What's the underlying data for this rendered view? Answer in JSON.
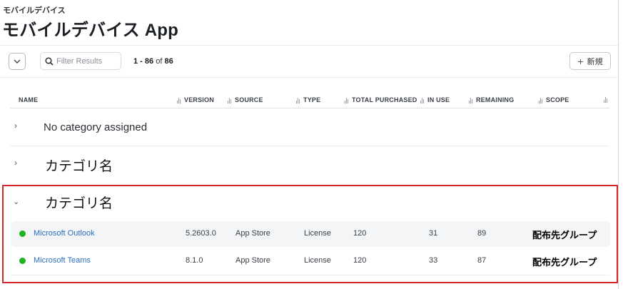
{
  "header": {
    "breadcrumb": "モバイルデバイス",
    "title": "モバイルデバイス App"
  },
  "toolbar": {
    "search_placeholder": "Filter Results",
    "pagination_range": "1 - 86",
    "pagination_of": "of",
    "pagination_total": "86",
    "new_button_label": "新規"
  },
  "table": {
    "columns": [
      {
        "label": "NAME"
      },
      {
        "label": "VERSION"
      },
      {
        "label": "SOURCE"
      },
      {
        "label": "TYPE"
      },
      {
        "label": "TOTAL PURCHASED"
      },
      {
        "label": "IN USE"
      },
      {
        "label": "REMAINING"
      },
      {
        "label": "SCOPE"
      }
    ],
    "categories": [
      {
        "label": "No category assigned",
        "expanded": false
      },
      {
        "label": "カテゴリ名",
        "expanded": false
      },
      {
        "label": "カテゴリ名",
        "expanded": true
      }
    ],
    "rows": [
      {
        "name": "Microsoft Outlook",
        "version": "5.2603.0",
        "source": "App Store",
        "type": "License",
        "total_purchased": "120",
        "in_use": "31",
        "remaining": "89",
        "scope": "配布先グループ",
        "status_color": "#1fb31f"
      },
      {
        "name": "Microsoft Teams",
        "version": "8.1.0",
        "source": "App Store",
        "type": "License",
        "total_purchased": "120",
        "in_use": "33",
        "remaining": "87",
        "scope": "配布先グループ",
        "status_color": "#1fb31f"
      }
    ]
  },
  "colors": {
    "link": "#2a6ebd",
    "status_green": "#1fb31f",
    "highlight_border": "#d62728"
  },
  "icons": {
    "collapse": "chevron-down-icon",
    "search": "search-icon",
    "new": "plus-icon",
    "sort": "sort-icon",
    "category_collapsed": "chevron-right-icon",
    "category_expanded": "chevron-down-icon"
  }
}
